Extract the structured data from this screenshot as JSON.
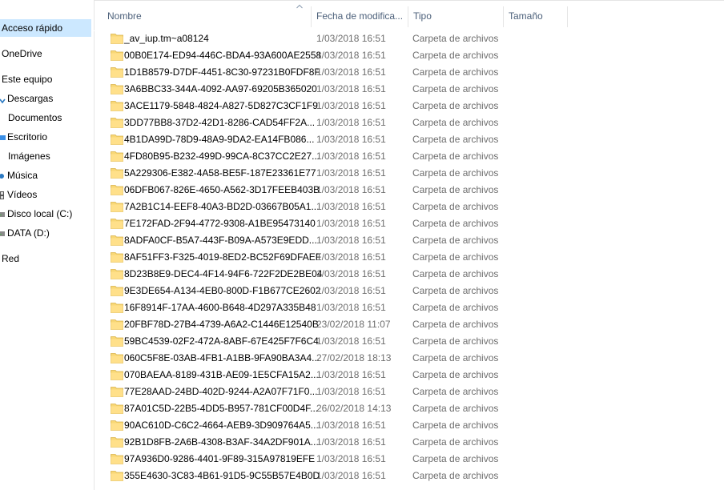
{
  "sidebar": {
    "items": [
      {
        "label": "Acceso rápido",
        "selected": true,
        "icon": ""
      },
      {
        "label": "OneDrive",
        "selected": false,
        "icon": ""
      },
      {
        "label": "Este equipo",
        "selected": false,
        "icon": ""
      },
      {
        "label": "Descargas",
        "selected": false,
        "icon": "download-arrow-icon"
      },
      {
        "label": "Documentos",
        "selected": false,
        "icon": ""
      },
      {
        "label": "Escritorio",
        "selected": false,
        "icon": "desktop-icon"
      },
      {
        "label": "Imágenes",
        "selected": false,
        "icon": ""
      },
      {
        "label": "Música",
        "selected": false,
        "icon": "music-icon"
      },
      {
        "label": "Vídeos",
        "selected": false,
        "icon": "film-icon"
      },
      {
        "label": "Disco local (C:)",
        "selected": false,
        "icon": "drive-icon"
      },
      {
        "label": "DATA (D:)",
        "selected": false,
        "icon": "drive-icon"
      },
      {
        "label": "Red",
        "selected": false,
        "icon": ""
      }
    ]
  },
  "columns": {
    "name": "Nombre",
    "date": "Fecha de modifica...",
    "type": "Tipo",
    "size": "Tamaño"
  },
  "files": [
    {
      "name": "_av_iup.tm~a08124",
      "date": "1/03/2018 16:51",
      "type": "Carpeta de archivos"
    },
    {
      "name": "00B0E174-ED94-446C-BDA4-93A600AE2558",
      "date": "1/03/2018 16:51",
      "type": "Carpeta de archivos"
    },
    {
      "name": "1D1B8579-D7DF-4451-8C30-97231B0FDF8F",
      "date": "1/03/2018 16:51",
      "type": "Carpeta de archivos"
    },
    {
      "name": "3A6BBC33-344A-4092-AA97-69205B365020",
      "date": "1/03/2018 16:51",
      "type": "Carpeta de archivos"
    },
    {
      "name": "3ACE1179-5848-4824-A827-5D827C3CF1F9",
      "date": "1/03/2018 16:51",
      "type": "Carpeta de archivos"
    },
    {
      "name": "3DD77BB8-37D2-42D1-8286-CAD54FF2A...",
      "date": "1/03/2018 16:51",
      "type": "Carpeta de archivos"
    },
    {
      "name": "4B1DA99D-78D9-48A9-9DA2-EA14FB086...",
      "date": "1/03/2018 16:51",
      "type": "Carpeta de archivos"
    },
    {
      "name": "4FD80B95-B232-499D-99CA-8C37CC2E27...",
      "date": "1/03/2018 16:51",
      "type": "Carpeta de archivos"
    },
    {
      "name": "5A229306-E382-4A58-BE5F-187E23361E77",
      "date": "1/03/2018 16:51",
      "type": "Carpeta de archivos"
    },
    {
      "name": "06DFB067-826E-4650-A562-3D17FEEB403B",
      "date": "1/03/2018 16:51",
      "type": "Carpeta de archivos"
    },
    {
      "name": "7A2B1C14-EEF8-40A3-BD2D-03667B05A1...",
      "date": "1/03/2018 16:51",
      "type": "Carpeta de archivos"
    },
    {
      "name": "7E172FAD-2F94-4772-9308-A1BE95473140",
      "date": "1/03/2018 16:51",
      "type": "Carpeta de archivos"
    },
    {
      "name": "8ADFA0CF-B5A7-443F-B09A-A573E9EDD...",
      "date": "1/03/2018 16:51",
      "type": "Carpeta de archivos"
    },
    {
      "name": "8AF51FF3-F325-4019-8ED2-BC52F69DFAEF",
      "date": "1/03/2018 16:51",
      "type": "Carpeta de archivos"
    },
    {
      "name": "8D23B8E9-DEC4-4F14-94F6-722F2DE2BE04",
      "date": "1/03/2018 16:51",
      "type": "Carpeta de archivos"
    },
    {
      "name": "9E3DE654-A134-4EB0-800D-F1B677CE2602",
      "date": "1/03/2018 16:51",
      "type": "Carpeta de archivos"
    },
    {
      "name": "16F8914F-17AA-4600-B648-4D297A335B48",
      "date": "1/03/2018 16:51",
      "type": "Carpeta de archivos"
    },
    {
      "name": "20FBF78D-27B4-4739-A6A2-C1446E12540B",
      "date": "23/02/2018 11:07",
      "type": "Carpeta de archivos"
    },
    {
      "name": "59BC4539-02F2-472A-8ABF-67E425F7F6C4",
      "date": "1/03/2018 16:51",
      "type": "Carpeta de archivos"
    },
    {
      "name": "060C5F8E-03AB-4FB1-A1BB-9FA90BA3A4...",
      "date": "27/02/2018 18:13",
      "type": "Carpeta de archivos"
    },
    {
      "name": "070BAEAA-8189-431B-AE09-1E5CFA15A2...",
      "date": "1/03/2018 16:51",
      "type": "Carpeta de archivos"
    },
    {
      "name": "77E28AAD-24BD-402D-9244-A2A07F71F0...",
      "date": "1/03/2018 16:51",
      "type": "Carpeta de archivos"
    },
    {
      "name": "87A01C5D-22B5-4DD5-B957-781CF00D4F...",
      "date": "26/02/2018 14:13",
      "type": "Carpeta de archivos"
    },
    {
      "name": "90AC610D-C6C2-4664-AEB9-3D909764A5...",
      "date": "1/03/2018 16:51",
      "type": "Carpeta de archivos"
    },
    {
      "name": "92B1D8FB-2A6B-4308-B3AF-34A2DF901A...",
      "date": "1/03/2018 16:51",
      "type": "Carpeta de archivos"
    },
    {
      "name": "97A936D0-9286-4401-9F89-315A97819EFE",
      "date": "1/03/2018 16:51",
      "type": "Carpeta de archivos"
    },
    {
      "name": "355E4630-3C83-4B61-91D5-9C55B57E4B0D",
      "date": "1/03/2018 16:51",
      "type": "Carpeta de archivos"
    }
  ],
  "colors": {
    "selected_bg": "#cce8ff",
    "header_text": "#4c607a",
    "secondary_text": "#6d6d6d",
    "folder": "#f8d775"
  }
}
